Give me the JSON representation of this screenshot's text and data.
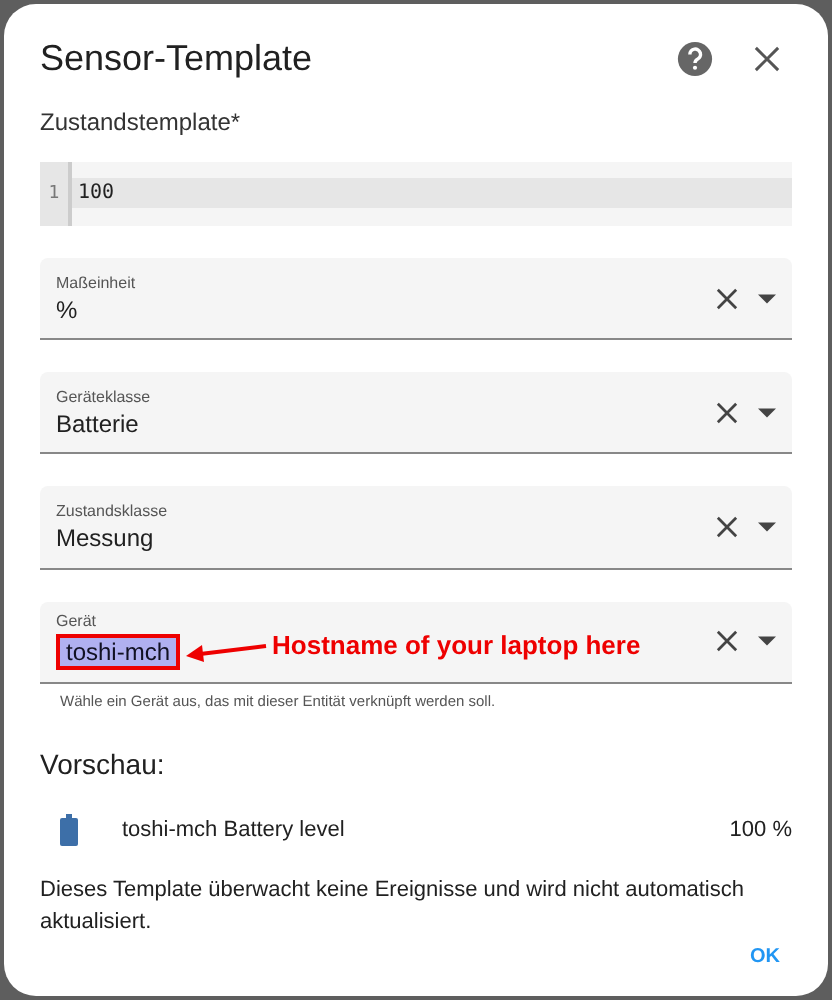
{
  "dialog": {
    "title": "Sensor-Template"
  },
  "template": {
    "label": "Zustandstemplate*",
    "lines": [
      {
        "number": "1",
        "text": "100"
      }
    ]
  },
  "fields": [
    {
      "label": "Maßeinheit",
      "value": "%"
    },
    {
      "label": "Geräteklasse",
      "value": "Batterie"
    },
    {
      "label": "Zustandsklasse",
      "value": "Messung"
    },
    {
      "label": "Gerät",
      "value": "toshi-mch",
      "helper": "Wähle ein Gerät aus, das mit dieser Entität verknüpft werden soll.",
      "annotation": "Hostname of your laptop here"
    }
  ],
  "preview": {
    "heading": "Vorschau:",
    "name": "toshi-mch Battery level",
    "value": "100 %",
    "note": "Dieses Template überwacht keine Ereignisse und wird nicht automatisch aktualisiert."
  },
  "buttons": [
    "OK"
  ]
}
